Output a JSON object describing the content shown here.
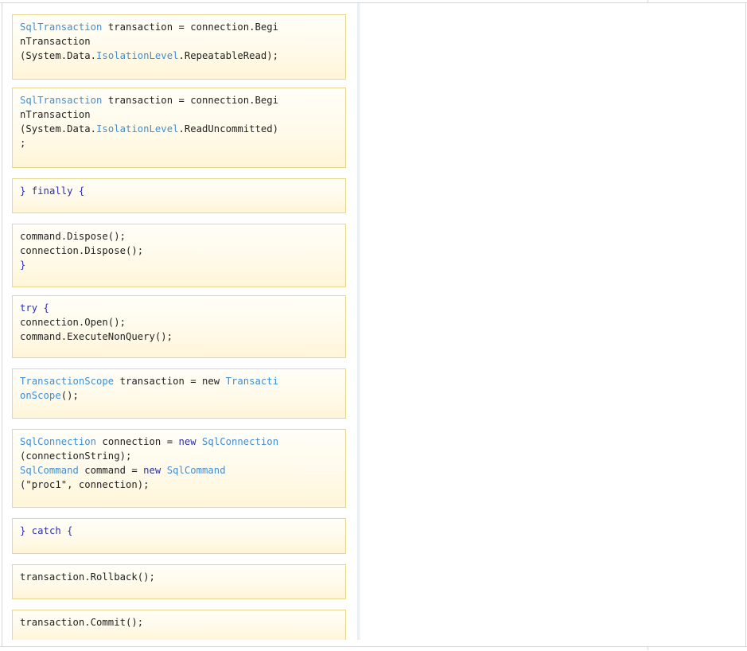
{
  "colors": {
    "type": "#3f8fd1",
    "keyword": "#2b2fa8",
    "plain": "#222222",
    "block_border": "#e9d68f",
    "block_fill": "#fff5d8"
  },
  "blocks": [
    {
      "id": "begin-tx-repeatable-read",
      "lines": [
        [
          {
            "t": "SqlTransaction",
            "k": "type"
          },
          {
            "t": " transaction = connection.Begi",
            "k": "plain"
          }
        ],
        [
          {
            "t": "nTransaction",
            "k": "plain"
          }
        ],
        [
          {
            "t": "(System.Data.",
            "k": "plain"
          },
          {
            "t": "IsolationLevel",
            "k": "type"
          },
          {
            "t": ".RepeatableRead);",
            "k": "plain"
          }
        ]
      ]
    },
    {
      "id": "begin-tx-read-uncommitted",
      "lines": [
        [
          {
            "t": "SqlTransaction",
            "k": "type"
          },
          {
            "t": " transaction = connection.Begi",
            "k": "plain"
          }
        ],
        [
          {
            "t": "nTransaction",
            "k": "plain"
          }
        ],
        [
          {
            "t": "(System.Data.",
            "k": "plain"
          },
          {
            "t": "IsolationLevel",
            "k": "type"
          },
          {
            "t": ".ReadUncommitted)",
            "k": "plain"
          }
        ],
        [
          {
            "t": ";",
            "k": "plain"
          }
        ]
      ]
    },
    {
      "id": "finally",
      "lines": [
        [
          {
            "t": "} ",
            "k": "keyword"
          },
          {
            "t": "finally",
            "k": "keyword"
          },
          {
            "t": " {",
            "k": "keyword"
          }
        ]
      ]
    },
    {
      "id": "dispose",
      "lines": [
        [
          {
            "t": "command.Dispose();",
            "k": "plain"
          }
        ],
        [
          {
            "t": "connection.Dispose();",
            "k": "plain"
          }
        ],
        [
          {
            "t": "}",
            "k": "keyword"
          }
        ]
      ]
    },
    {
      "id": "try-open-execute",
      "lines": [
        [
          {
            "t": "try",
            "k": "keyword"
          },
          {
            "t": " {",
            "k": "keyword"
          }
        ],
        [
          {
            "t": "connection.Open();",
            "k": "plain"
          }
        ],
        [
          {
            "t": "command.ExecuteNonQuery();",
            "k": "plain"
          }
        ]
      ]
    },
    {
      "id": "transaction-scope",
      "lines": [
        [
          {
            "t": "TransactionScope",
            "k": "type"
          },
          {
            "t": " transaction = new ",
            "k": "plain"
          },
          {
            "t": "Transacti",
            "k": "type"
          }
        ],
        [
          {
            "t": "onScope",
            "k": "type"
          },
          {
            "t": "();",
            "k": "plain"
          }
        ]
      ]
    },
    {
      "id": "connection-command",
      "lines": [
        [
          {
            "t": "SqlConnection",
            "k": "type"
          },
          {
            "t": " connection = ",
            "k": "plain"
          },
          {
            "t": "new",
            "k": "keyword"
          },
          {
            "t": " ",
            "k": "plain"
          },
          {
            "t": "SqlConnection",
            "k": "type"
          }
        ],
        [
          {
            "t": "(connectionString);",
            "k": "plain"
          }
        ],
        [
          {
            "t": "SqlCommand",
            "k": "type"
          },
          {
            "t": " command = ",
            "k": "plain"
          },
          {
            "t": "new",
            "k": "keyword"
          },
          {
            "t": " ",
            "k": "plain"
          },
          {
            "t": "SqlCommand",
            "k": "type"
          }
        ],
        [
          {
            "t": "(\"proc1\", connection);",
            "k": "plain"
          }
        ]
      ]
    },
    {
      "id": "catch",
      "lines": [
        [
          {
            "t": "} ",
            "k": "keyword"
          },
          {
            "t": "catch",
            "k": "keyword"
          },
          {
            "t": " {",
            "k": "keyword"
          }
        ]
      ]
    },
    {
      "id": "rollback",
      "lines": [
        [
          {
            "t": "transaction.Rollback();",
            "k": "plain"
          }
        ]
      ]
    },
    {
      "id": "commit",
      "lines": [
        [
          {
            "t": "transaction.Commit();",
            "k": "plain"
          }
        ]
      ]
    }
  ]
}
